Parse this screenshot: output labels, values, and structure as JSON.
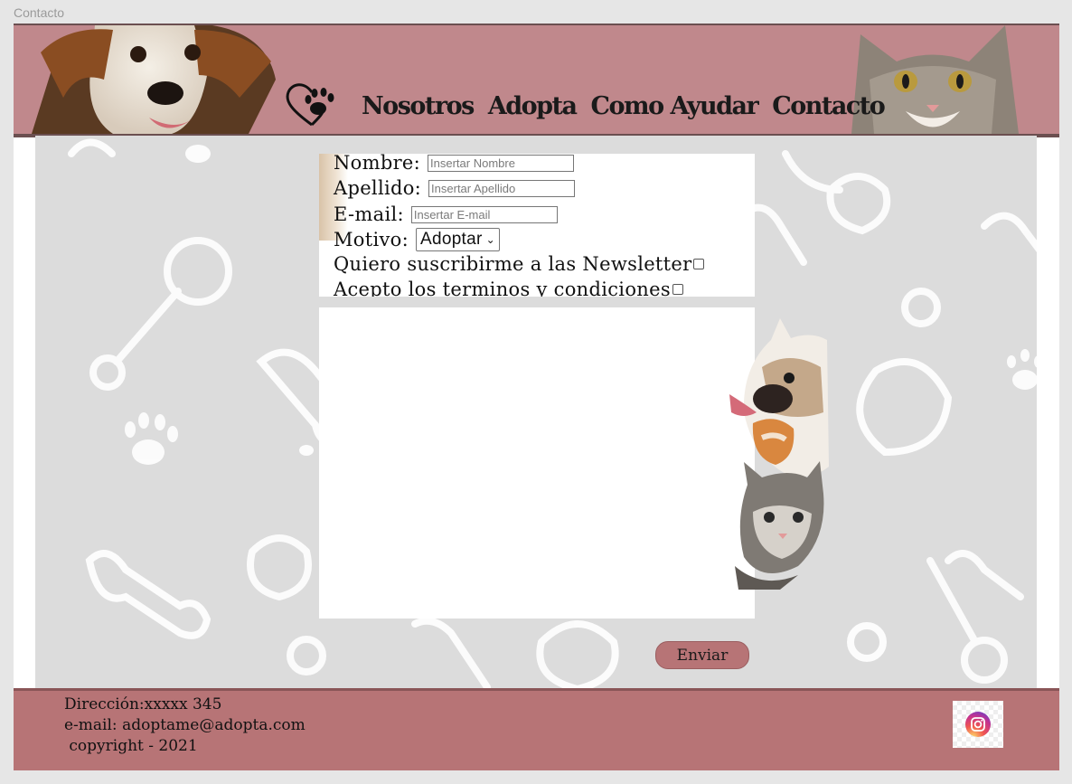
{
  "page": {
    "label": "Contacto"
  },
  "colors": {
    "header": "#c0888c",
    "footer": "#b77476",
    "button": "#b77476",
    "background": "#dcdcdc"
  },
  "nav": {
    "items": [
      "Nosotros",
      "Adopta",
      "Como Ayudar",
      "Contacto"
    ],
    "logo_icon": "heart-paw-icon"
  },
  "form": {
    "nombre_label": "Nombre:",
    "nombre_placeholder": "Insertar Nombre",
    "apellido_label": "Apellido:",
    "apellido_placeholder": "Insertar Apellido",
    "email_label": "E-mail:",
    "email_placeholder": "Insertar E-mail",
    "motivo_label": "Motivo:",
    "motivo_value": "Adoptar",
    "newsletter_label": "Quiero suscribirme a las Newsletter",
    "terms_label": "Acepto los terminos y condiciones",
    "send_label": "Enviar"
  },
  "footer": {
    "address": "Dirección:xxxxx 345",
    "email": "e-mail: adoptame@adopta.com",
    "copyright": " copyright - 2021",
    "social_icon": "instagram-icon"
  }
}
